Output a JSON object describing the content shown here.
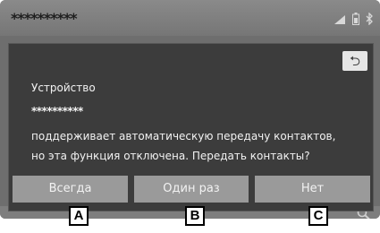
{
  "statusbar": {
    "device_name": "**********"
  },
  "dialog": {
    "back_label": "⮌",
    "title": "Устройство",
    "device": "**********",
    "line1": "поддерживает автоматическую передачу контактов,",
    "line2": "но эта функция отключена. Передать контакты?"
  },
  "buttons": {
    "always": "Всегда",
    "once": "Один раз",
    "no": "Нет"
  },
  "callouts": {
    "a": "A",
    "b": "B",
    "c": "C"
  },
  "colors": {
    "dialog_bg": "#3c3c3c",
    "button_bg": "#9a9a9a",
    "screen_bg": "#6e6e6e"
  }
}
